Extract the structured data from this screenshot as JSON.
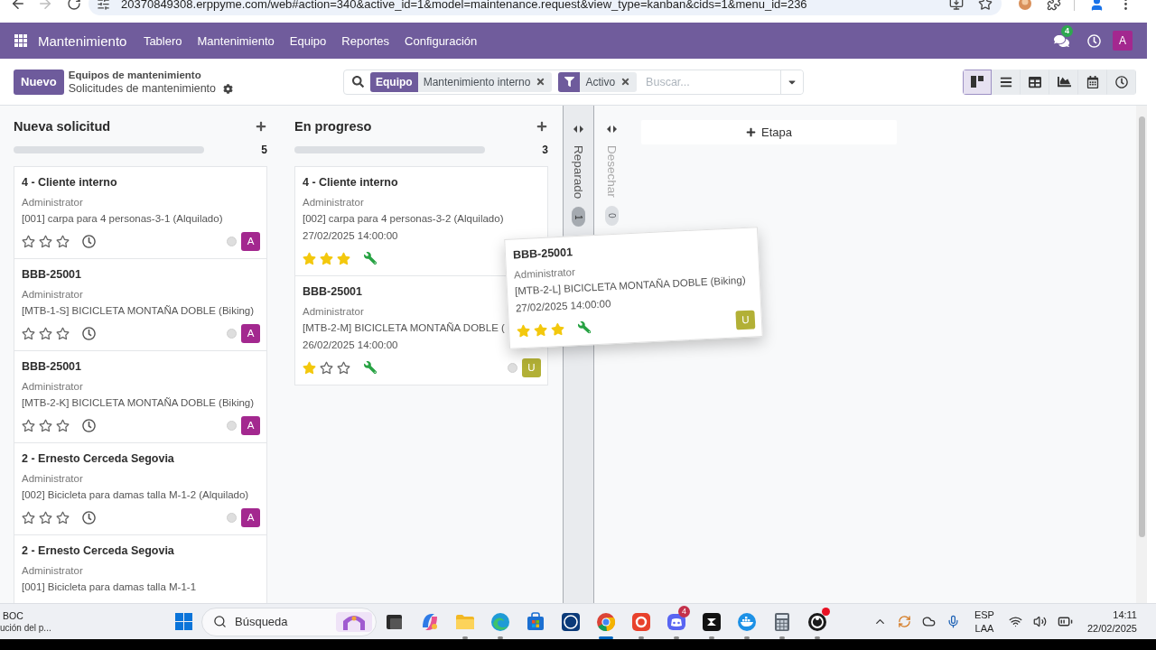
{
  "browser": {
    "url": "20370849308.erppyme.com/web#action=340&active_id=1&model=maintenance.request&view_type=kanban&cids=1&menu_id=236",
    "forward_disabled": true
  },
  "navbar": {
    "app_name": "Mantenimiento",
    "menu": [
      "Tablero",
      "Mantenimiento",
      "Equipo",
      "Reportes",
      "Configuración"
    ],
    "messages_badge": "4",
    "avatar": {
      "letter": "A",
      "color": "#a3288f"
    }
  },
  "control_panel": {
    "new_button": "Nuevo",
    "breadcrumb": "Equipos de mantenimiento",
    "title": "Solicitudes de mantenimiento",
    "search": {
      "facets": [
        {
          "kind": "group",
          "label": "Equipo",
          "value": "Mantenimiento interno"
        },
        {
          "kind": "filter",
          "value": "Activo"
        }
      ],
      "placeholder": "Buscar..."
    },
    "views": [
      {
        "kind": "kanban",
        "selected": true
      },
      {
        "kind": "list",
        "selected": false
      },
      {
        "kind": "pivot",
        "selected": false
      },
      {
        "kind": "graph",
        "selected": false
      },
      {
        "kind": "calendar",
        "selected": false
      },
      {
        "kind": "activity",
        "selected": false
      }
    ]
  },
  "kanban": {
    "columns": [
      {
        "title": "Nueva solicitud",
        "count": "5",
        "level": 1,
        "cards": [
          {
            "title": "4 - Cliente interno",
            "user": "Administrator",
            "equipment": "[001] carpa para 4 personas-3-1 (Alquilado)",
            "stars": 0,
            "activity_scheduled": false,
            "ready": false,
            "avatar": {
              "letter": "A",
              "color": "#a3288f"
            }
          },
          {
            "title": "BBB-25001",
            "user": "Administrator",
            "equipment": "[MTB-1-S] BICICLETA MONTAÑA DOBLE (Biking)",
            "stars": 0,
            "activity_scheduled": false,
            "ready": false,
            "avatar": {
              "letter": "A",
              "color": "#a3288f"
            }
          },
          {
            "title": "BBB-25001",
            "user": "Administrator",
            "equipment": "[MTB-2-K] BICICLETA MONTAÑA DOBLE (Biking)",
            "stars": 0,
            "activity_scheduled": false,
            "ready": false,
            "avatar": {
              "letter": "A",
              "color": "#a3288f"
            }
          },
          {
            "title": "2 - Ernesto Cerceda Segovia",
            "user": "Administrator",
            "equipment": "[002] Bicicleta para damas talla M-1-2 (Alquilado)",
            "stars": 0,
            "activity_scheduled": false,
            "ready": false,
            "avatar": {
              "letter": "A",
              "color": "#a3288f"
            }
          },
          {
            "title": "2 - Ernesto Cerceda Segovia",
            "user": "Administrator",
            "equipment": "[001] Bicicleta para damas talla M-1-1"
          }
        ]
      },
      {
        "title": "En progreso",
        "count": "3",
        "level": 1,
        "cards": [
          {
            "title": "4 - Cliente interno",
            "user": "Administrator",
            "equipment": "[002] carpa para 4 personas-3-2 (Alquilado)",
            "date": "27/02/2025 14:00:00",
            "stars": 3,
            "activity_scheduled": true
          },
          {
            "title": "BBB-25001",
            "user": "Administrator",
            "equipment": "[MTB-2-M] BICICLETA MONTAÑA DOBLE (",
            "date": "26/02/2025 14:00:00",
            "stars": 1,
            "activity_scheduled": true,
            "ready": false,
            "avatar": {
              "letter": "U",
              "color": "#b2b036"
            }
          }
        ]
      }
    ],
    "folded_columns": [
      {
        "title": "Reparado",
        "count": "1",
        "drop_target": true
      },
      {
        "title": "Desechar",
        "count": "0",
        "drop_target": false
      }
    ],
    "add_stage": "Etapa",
    "dragged_card": {
      "title": "BBB-25001",
      "user": "Administrator",
      "equipment": "[MTB-2-L] BICICLETA MONTAÑA DOBLE (Biking)",
      "date": "27/02/2025 14:00:00",
      "stars": 3,
      "activity_scheduled": true,
      "avatar": {
        "letter": "U",
        "color": "#b2b036"
      }
    }
  },
  "taskbar": {
    "widget": {
      "title": "BOC",
      "subtitle": "ución del p..."
    },
    "search_placeholder": "Búsqueda",
    "apps": [
      {
        "kind": "task-view",
        "running": false,
        "selected": false,
        "alert": false
      },
      {
        "kind": "copilot",
        "running": false,
        "selected": false,
        "alert": false
      },
      {
        "kind": "folder",
        "running": true,
        "selected": false,
        "alert": false
      },
      {
        "kind": "edge",
        "running": true,
        "selected": false,
        "alert": false
      },
      {
        "kind": "store",
        "running": false,
        "selected": false,
        "alert": false
      },
      {
        "kind": "dell",
        "running": false,
        "selected": false,
        "alert": false
      },
      {
        "kind": "chrome",
        "running": true,
        "selected": true,
        "alert": false
      },
      {
        "kind": "wps",
        "running": true,
        "selected": false,
        "alert": false
      },
      {
        "kind": "discord",
        "running": true,
        "selected": false,
        "alert": false,
        "badge": "4"
      },
      {
        "kind": "dark",
        "running": true,
        "selected": false,
        "alert": false
      },
      {
        "kind": "docker",
        "running": true,
        "selected": false,
        "alert": false
      },
      {
        "kind": "calculator",
        "running": true,
        "selected": false,
        "alert": false
      },
      {
        "kind": "obs",
        "running": true,
        "selected": false,
        "alert": true
      }
    ],
    "tray": {
      "language": "ESP",
      "layout": "LAA",
      "time": "14:11",
      "date": "22/02/2025"
    }
  }
}
